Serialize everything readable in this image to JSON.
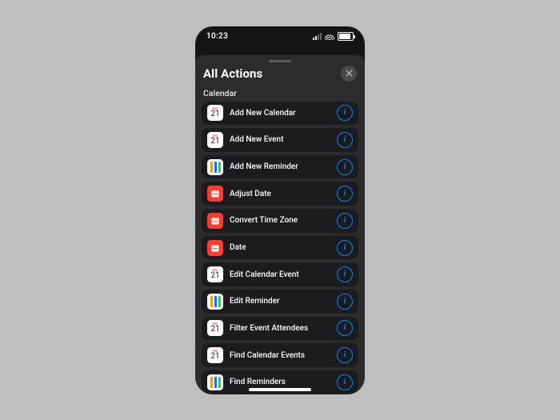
{
  "status": {
    "time": "10:23"
  },
  "sheet": {
    "title": "All Actions",
    "section": "Calendar"
  },
  "cal_icon": {
    "month": "FRI",
    "day": "21"
  },
  "actions": [
    {
      "icon": "cal-white",
      "label": "Add New Calendar"
    },
    {
      "icon": "cal-white",
      "label": "Add New Event"
    },
    {
      "icon": "rem",
      "label": "Add New Reminder"
    },
    {
      "icon": "cal-red",
      "label": "Adjust Date"
    },
    {
      "icon": "cal-red",
      "label": "Convert Time Zone"
    },
    {
      "icon": "cal-red",
      "label": "Date"
    },
    {
      "icon": "cal-white",
      "label": "Edit Calendar Event"
    },
    {
      "icon": "rem",
      "label": "Edit Reminder"
    },
    {
      "icon": "cal-white",
      "label": "Filter Event Attendees"
    },
    {
      "icon": "cal-white",
      "label": "Find Calendar Events"
    },
    {
      "icon": "rem",
      "label": "Find Reminders"
    }
  ]
}
